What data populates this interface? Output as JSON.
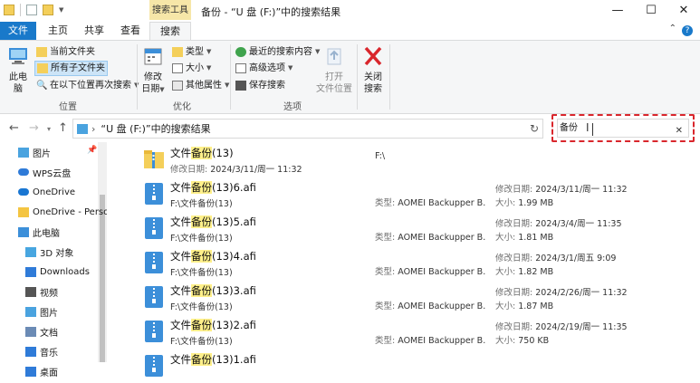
{
  "window": {
    "title": "备份 - “U 盘 (F:)”中的搜索结果",
    "context_group": "搜索工具",
    "minimize": "—",
    "maximize": "☐",
    "close": "✕"
  },
  "tabs": [
    "文件",
    "主页",
    "共享",
    "查看",
    "搜索"
  ],
  "ribbon": {
    "this_pc_label_1": "此电",
    "this_pc_label_2": "脑",
    "current_folder": "当前文件夹",
    "all_subfolders": "所有子文件夹",
    "search_again": "在以下位置再次搜索",
    "location_group": "位置",
    "modified_1": "修改",
    "modified_2": "日期",
    "type": "类型",
    "size": "大小",
    "other_props": "其他属性",
    "refine_group": "优化",
    "recent_searches": "最近的搜索内容",
    "advanced": "高级选项",
    "save_search": "保存搜索",
    "open_location_1": "打开",
    "open_location_2": "文件位置",
    "options_group": "选项",
    "close_search_1": "关闭",
    "close_search_2": "搜索"
  },
  "address": {
    "path": "“U 盘 (F:)”中的搜索结果",
    "separator": "›"
  },
  "search": {
    "value": "备份",
    "clear": "✕"
  },
  "nav": {
    "items": [
      {
        "label": "图片",
        "icon": "pictures-icon",
        "color": "#4aa3df"
      },
      {
        "label": "WPS云盘",
        "icon": "cloud-icon",
        "color": "#2f7bd8"
      },
      {
        "label": "OneDrive",
        "icon": "onedrive-icon",
        "color": "#1976d2"
      },
      {
        "label": "OneDrive - Personal",
        "icon": "folder-icon",
        "color": "#f4c542"
      },
      {
        "label": "此电脑",
        "icon": "computer-icon",
        "color": "#3c8fd9"
      },
      {
        "label": "3D 对象",
        "icon": "3d-objects-icon",
        "color": "#48a6e0"
      },
      {
        "label": "Downloads",
        "icon": "download-icon",
        "color": "#2f7bd8"
      },
      {
        "label": "视频",
        "icon": "videos-icon",
        "color": "#555"
      },
      {
        "label": "图片",
        "icon": "pictures-icon",
        "color": "#4aa3df"
      },
      {
        "label": "文档",
        "icon": "documents-icon",
        "color": "#6b8bb5"
      },
      {
        "label": "音乐",
        "icon": "music-icon",
        "color": "#2f7bd8"
      },
      {
        "label": "桌面",
        "icon": "desktop-icon",
        "color": "#2f7bd8"
      }
    ]
  },
  "files": [
    {
      "pre": "文件",
      "mark": "备份",
      "post": "(13)",
      "sub_pre": "修改日期: ",
      "sub": "2024/3/11/周一 11:32",
      "col2": "F:\\",
      "kind": "folder"
    },
    {
      "pre": "文件",
      "mark": "备份",
      "post": "(13)6.afi",
      "sub_pre": "F:\\文件",
      "sub_mark": "备份",
      "sub_post": "(13)",
      "type": "AOMEI Backupper B...",
      "date": "2024/3/11/周一 11:32",
      "size": "1.99 MB",
      "kind": "file"
    },
    {
      "pre": "文件",
      "mark": "备份",
      "post": "(13)5.afi",
      "sub_pre": "F:\\文件",
      "sub_mark": "备份",
      "sub_post": "(13)",
      "type": "AOMEI Backupper B...",
      "date": "2024/3/4/周一 11:35",
      "size": "1.81 MB",
      "kind": "file"
    },
    {
      "pre": "文件",
      "mark": "备份",
      "post": "(13)4.afi",
      "sub_pre": "F:\\文件",
      "sub_mark": "备份",
      "sub_post": "(13)",
      "type": "AOMEI Backupper B...",
      "date": "2024/3/1/周五 9:09",
      "size": "1.82 MB",
      "kind": "file"
    },
    {
      "pre": "文件",
      "mark": "备份",
      "post": "(13)3.afi",
      "sub_pre": "F:\\文件",
      "sub_mark": "备份",
      "sub_post": "(13)",
      "type": "AOMEI Backupper B...",
      "date": "2024/2/26/周一 11:32",
      "size": "1.87 MB",
      "kind": "file"
    },
    {
      "pre": "文件",
      "mark": "备份",
      "post": "(13)2.afi",
      "sub_pre": "F:\\文件",
      "sub_mark": "备份",
      "sub_post": "(13)",
      "type": "AOMEI Backupper B...",
      "date": "2024/2/19/周一 11:35",
      "size": "750 KB",
      "kind": "file"
    },
    {
      "pre": "文件",
      "mark": "备份",
      "post": "(13)1.afi",
      "sub_pre": "",
      "type": "",
      "date": "",
      "size": "",
      "kind": "file"
    }
  ],
  "labels": {
    "type": "类型: ",
    "date": "修改日期: ",
    "size": "大小: "
  }
}
